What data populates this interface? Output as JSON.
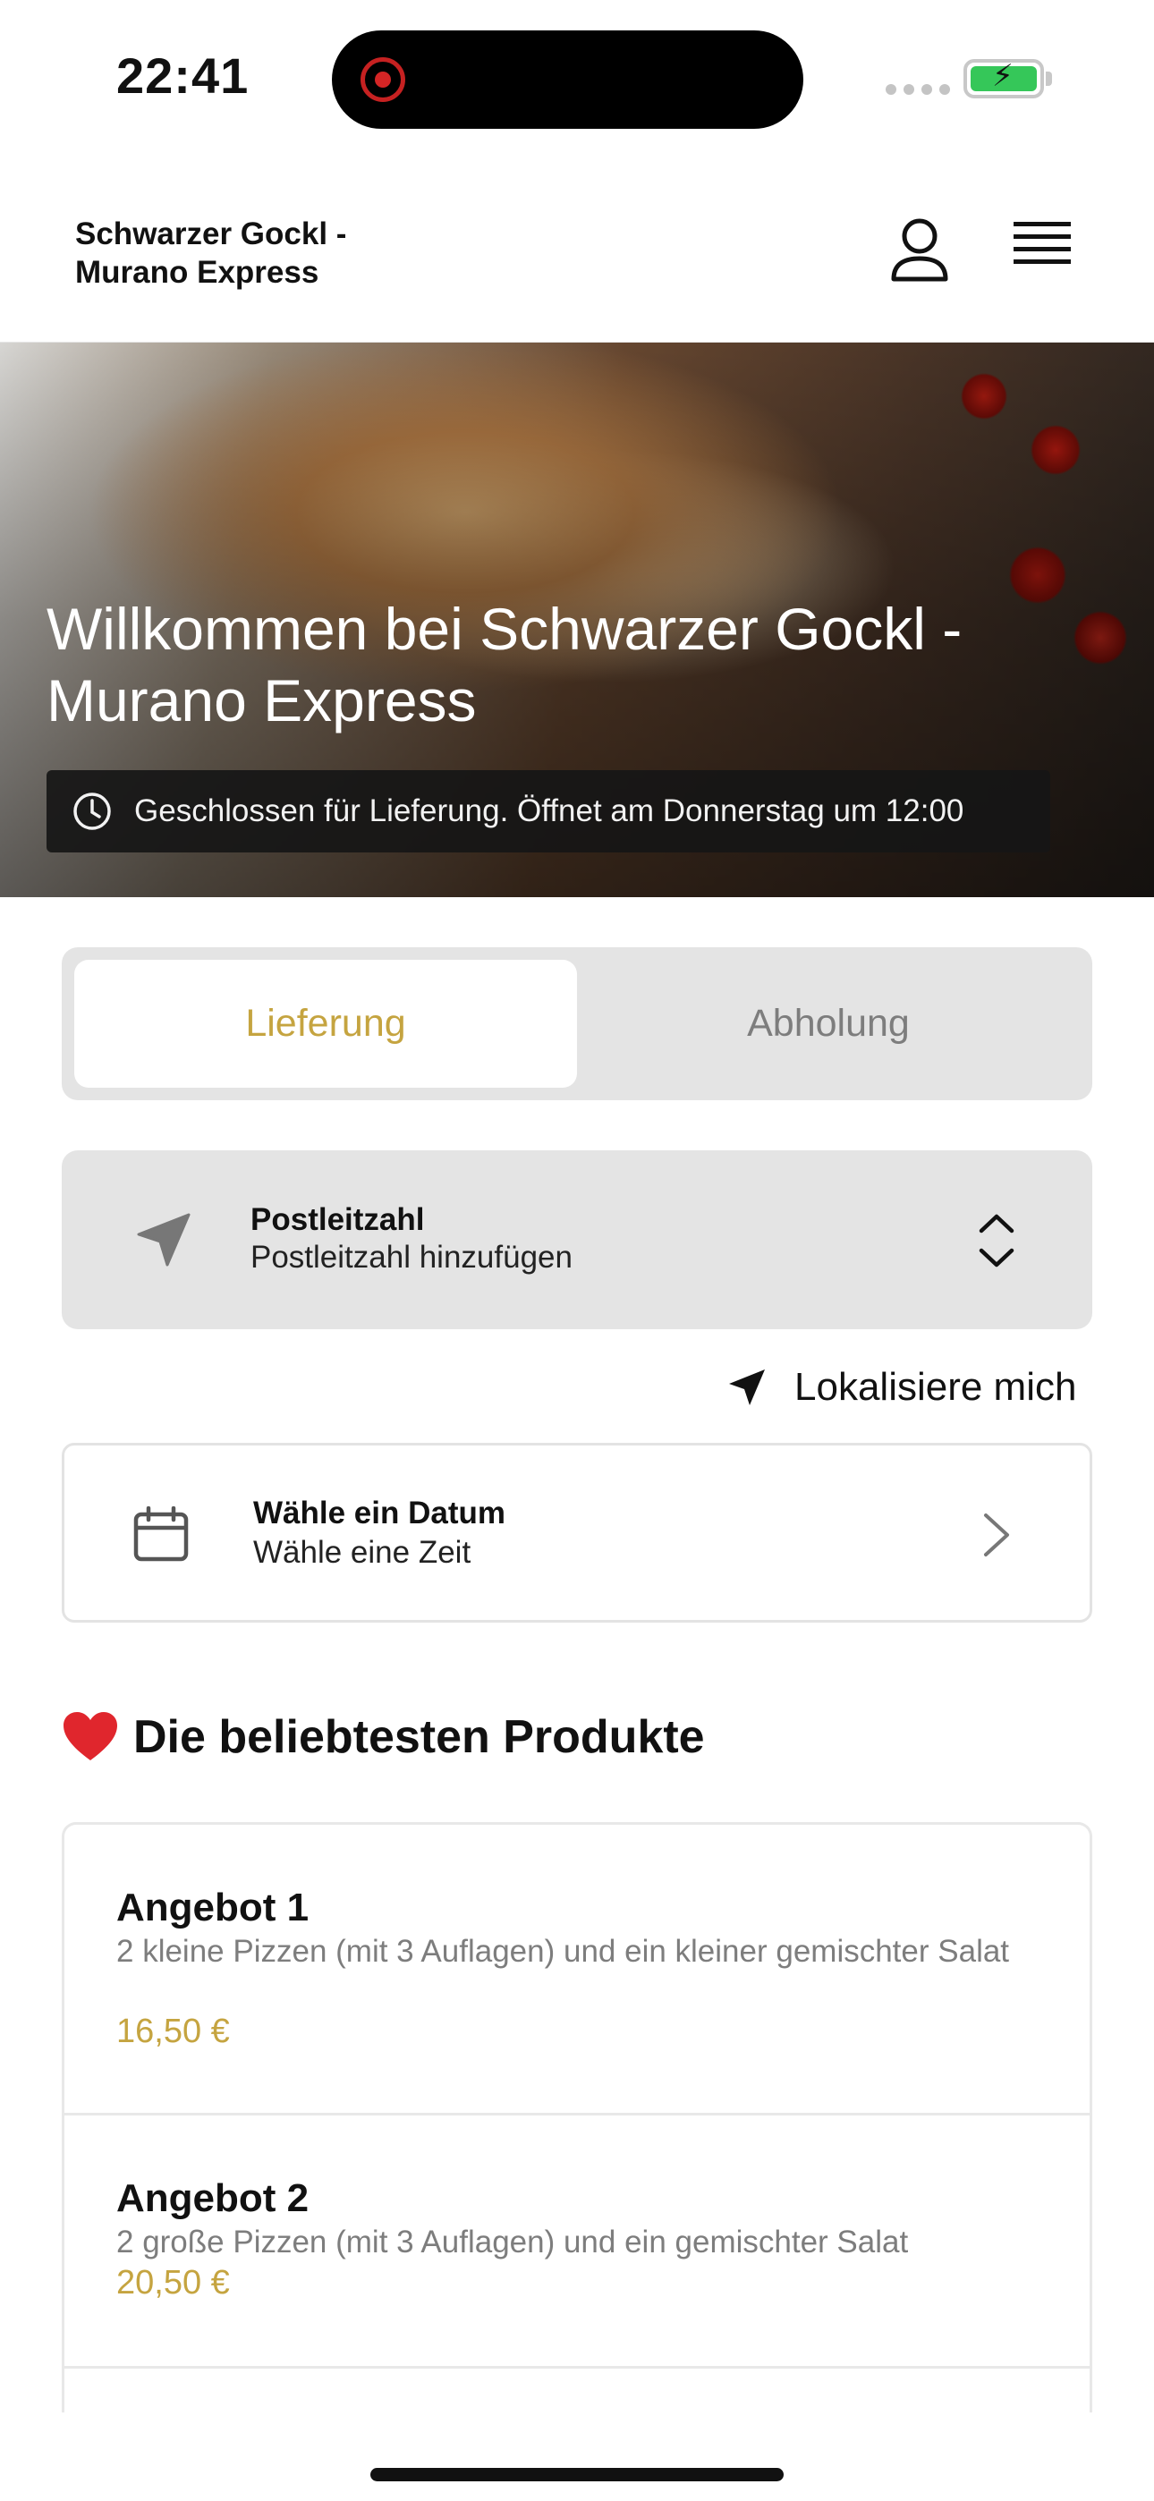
{
  "status_bar": {
    "time": "22:41",
    "recording_color": "#d42525",
    "battery_color": "#35c759"
  },
  "header": {
    "title": "Schwarzer Gockl - Murano Express",
    "user_icon": "user-icon",
    "menu_icon": "hamburger-menu-icon"
  },
  "hero": {
    "title": "Willkommen bei Schwarzer Gockl - Murano Express",
    "closed_message": "Geschlossen für Lieferung. Öffnet am Donnerstag um 12:00"
  },
  "order_mode": {
    "tabs": [
      {
        "label": "Lieferung",
        "active": true
      },
      {
        "label": "Abholung",
        "active": false
      }
    ],
    "accent_color": "#c5a440"
  },
  "postcode": {
    "label": "Postleitzahl",
    "value": "Postleitzahl hinzufügen"
  },
  "locate": {
    "label": "Lokalisiere mich"
  },
  "date_picker": {
    "label": "Wähle ein Datum",
    "value": "Wähle eine Zeit"
  },
  "popular": {
    "title": "Die beliebtesten Produkte",
    "products": [
      {
        "name": "Angebot 1",
        "description": "2 kleine Pizzen (mit 3 Auflagen) und ein kleiner gemischter Salat",
        "price": "16,50 €"
      },
      {
        "name": "Angebot 2",
        "description": "2 große Pizzen (mit 3 Auflagen) und ein gemischter Salat",
        "price": "20,50 €"
      }
    ]
  }
}
